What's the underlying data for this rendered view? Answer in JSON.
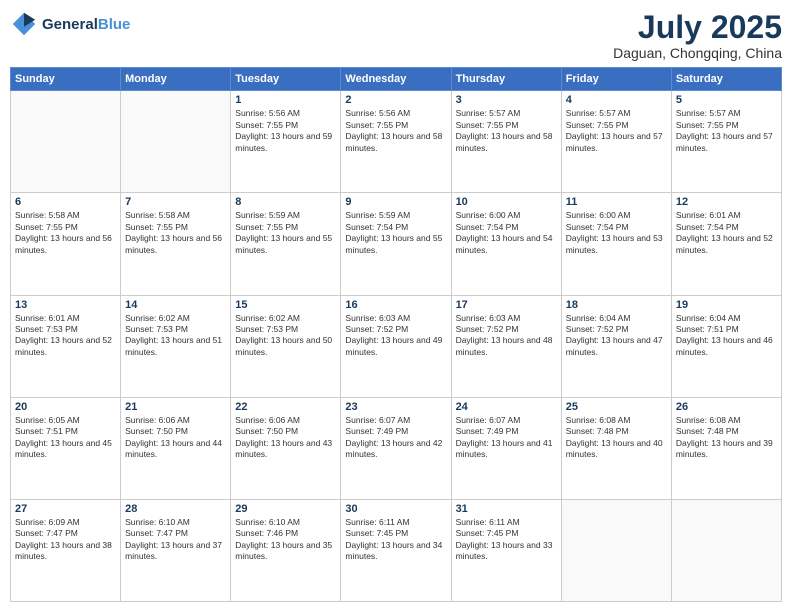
{
  "logo": {
    "line1": "General",
    "line2": "Blue"
  },
  "header": {
    "month_year": "July 2025",
    "location": "Daguan, Chongqing, China"
  },
  "days_of_week": [
    "Sunday",
    "Monday",
    "Tuesday",
    "Wednesday",
    "Thursday",
    "Friday",
    "Saturday"
  ],
  "weeks": [
    [
      {
        "day": "",
        "content": ""
      },
      {
        "day": "",
        "content": ""
      },
      {
        "day": "1",
        "content": "Sunrise: 5:56 AM\nSunset: 7:55 PM\nDaylight: 13 hours and 59 minutes."
      },
      {
        "day": "2",
        "content": "Sunrise: 5:56 AM\nSunset: 7:55 PM\nDaylight: 13 hours and 58 minutes."
      },
      {
        "day": "3",
        "content": "Sunrise: 5:57 AM\nSunset: 7:55 PM\nDaylight: 13 hours and 58 minutes."
      },
      {
        "day": "4",
        "content": "Sunrise: 5:57 AM\nSunset: 7:55 PM\nDaylight: 13 hours and 57 minutes."
      },
      {
        "day": "5",
        "content": "Sunrise: 5:57 AM\nSunset: 7:55 PM\nDaylight: 13 hours and 57 minutes."
      }
    ],
    [
      {
        "day": "6",
        "content": "Sunrise: 5:58 AM\nSunset: 7:55 PM\nDaylight: 13 hours and 56 minutes."
      },
      {
        "day": "7",
        "content": "Sunrise: 5:58 AM\nSunset: 7:55 PM\nDaylight: 13 hours and 56 minutes."
      },
      {
        "day": "8",
        "content": "Sunrise: 5:59 AM\nSunset: 7:55 PM\nDaylight: 13 hours and 55 minutes."
      },
      {
        "day": "9",
        "content": "Sunrise: 5:59 AM\nSunset: 7:54 PM\nDaylight: 13 hours and 55 minutes."
      },
      {
        "day": "10",
        "content": "Sunrise: 6:00 AM\nSunset: 7:54 PM\nDaylight: 13 hours and 54 minutes."
      },
      {
        "day": "11",
        "content": "Sunrise: 6:00 AM\nSunset: 7:54 PM\nDaylight: 13 hours and 53 minutes."
      },
      {
        "day": "12",
        "content": "Sunrise: 6:01 AM\nSunset: 7:54 PM\nDaylight: 13 hours and 52 minutes."
      }
    ],
    [
      {
        "day": "13",
        "content": "Sunrise: 6:01 AM\nSunset: 7:53 PM\nDaylight: 13 hours and 52 minutes."
      },
      {
        "day": "14",
        "content": "Sunrise: 6:02 AM\nSunset: 7:53 PM\nDaylight: 13 hours and 51 minutes."
      },
      {
        "day": "15",
        "content": "Sunrise: 6:02 AM\nSunset: 7:53 PM\nDaylight: 13 hours and 50 minutes."
      },
      {
        "day": "16",
        "content": "Sunrise: 6:03 AM\nSunset: 7:52 PM\nDaylight: 13 hours and 49 minutes."
      },
      {
        "day": "17",
        "content": "Sunrise: 6:03 AM\nSunset: 7:52 PM\nDaylight: 13 hours and 48 minutes."
      },
      {
        "day": "18",
        "content": "Sunrise: 6:04 AM\nSunset: 7:52 PM\nDaylight: 13 hours and 47 minutes."
      },
      {
        "day": "19",
        "content": "Sunrise: 6:04 AM\nSunset: 7:51 PM\nDaylight: 13 hours and 46 minutes."
      }
    ],
    [
      {
        "day": "20",
        "content": "Sunrise: 6:05 AM\nSunset: 7:51 PM\nDaylight: 13 hours and 45 minutes."
      },
      {
        "day": "21",
        "content": "Sunrise: 6:06 AM\nSunset: 7:50 PM\nDaylight: 13 hours and 44 minutes."
      },
      {
        "day": "22",
        "content": "Sunrise: 6:06 AM\nSunset: 7:50 PM\nDaylight: 13 hours and 43 minutes."
      },
      {
        "day": "23",
        "content": "Sunrise: 6:07 AM\nSunset: 7:49 PM\nDaylight: 13 hours and 42 minutes."
      },
      {
        "day": "24",
        "content": "Sunrise: 6:07 AM\nSunset: 7:49 PM\nDaylight: 13 hours and 41 minutes."
      },
      {
        "day": "25",
        "content": "Sunrise: 6:08 AM\nSunset: 7:48 PM\nDaylight: 13 hours and 40 minutes."
      },
      {
        "day": "26",
        "content": "Sunrise: 6:08 AM\nSunset: 7:48 PM\nDaylight: 13 hours and 39 minutes."
      }
    ],
    [
      {
        "day": "27",
        "content": "Sunrise: 6:09 AM\nSunset: 7:47 PM\nDaylight: 13 hours and 38 minutes."
      },
      {
        "day": "28",
        "content": "Sunrise: 6:10 AM\nSunset: 7:47 PM\nDaylight: 13 hours and 37 minutes."
      },
      {
        "day": "29",
        "content": "Sunrise: 6:10 AM\nSunset: 7:46 PM\nDaylight: 13 hours and 35 minutes."
      },
      {
        "day": "30",
        "content": "Sunrise: 6:11 AM\nSunset: 7:45 PM\nDaylight: 13 hours and 34 minutes."
      },
      {
        "day": "31",
        "content": "Sunrise: 6:11 AM\nSunset: 7:45 PM\nDaylight: 13 hours and 33 minutes."
      },
      {
        "day": "",
        "content": ""
      },
      {
        "day": "",
        "content": ""
      }
    ]
  ]
}
